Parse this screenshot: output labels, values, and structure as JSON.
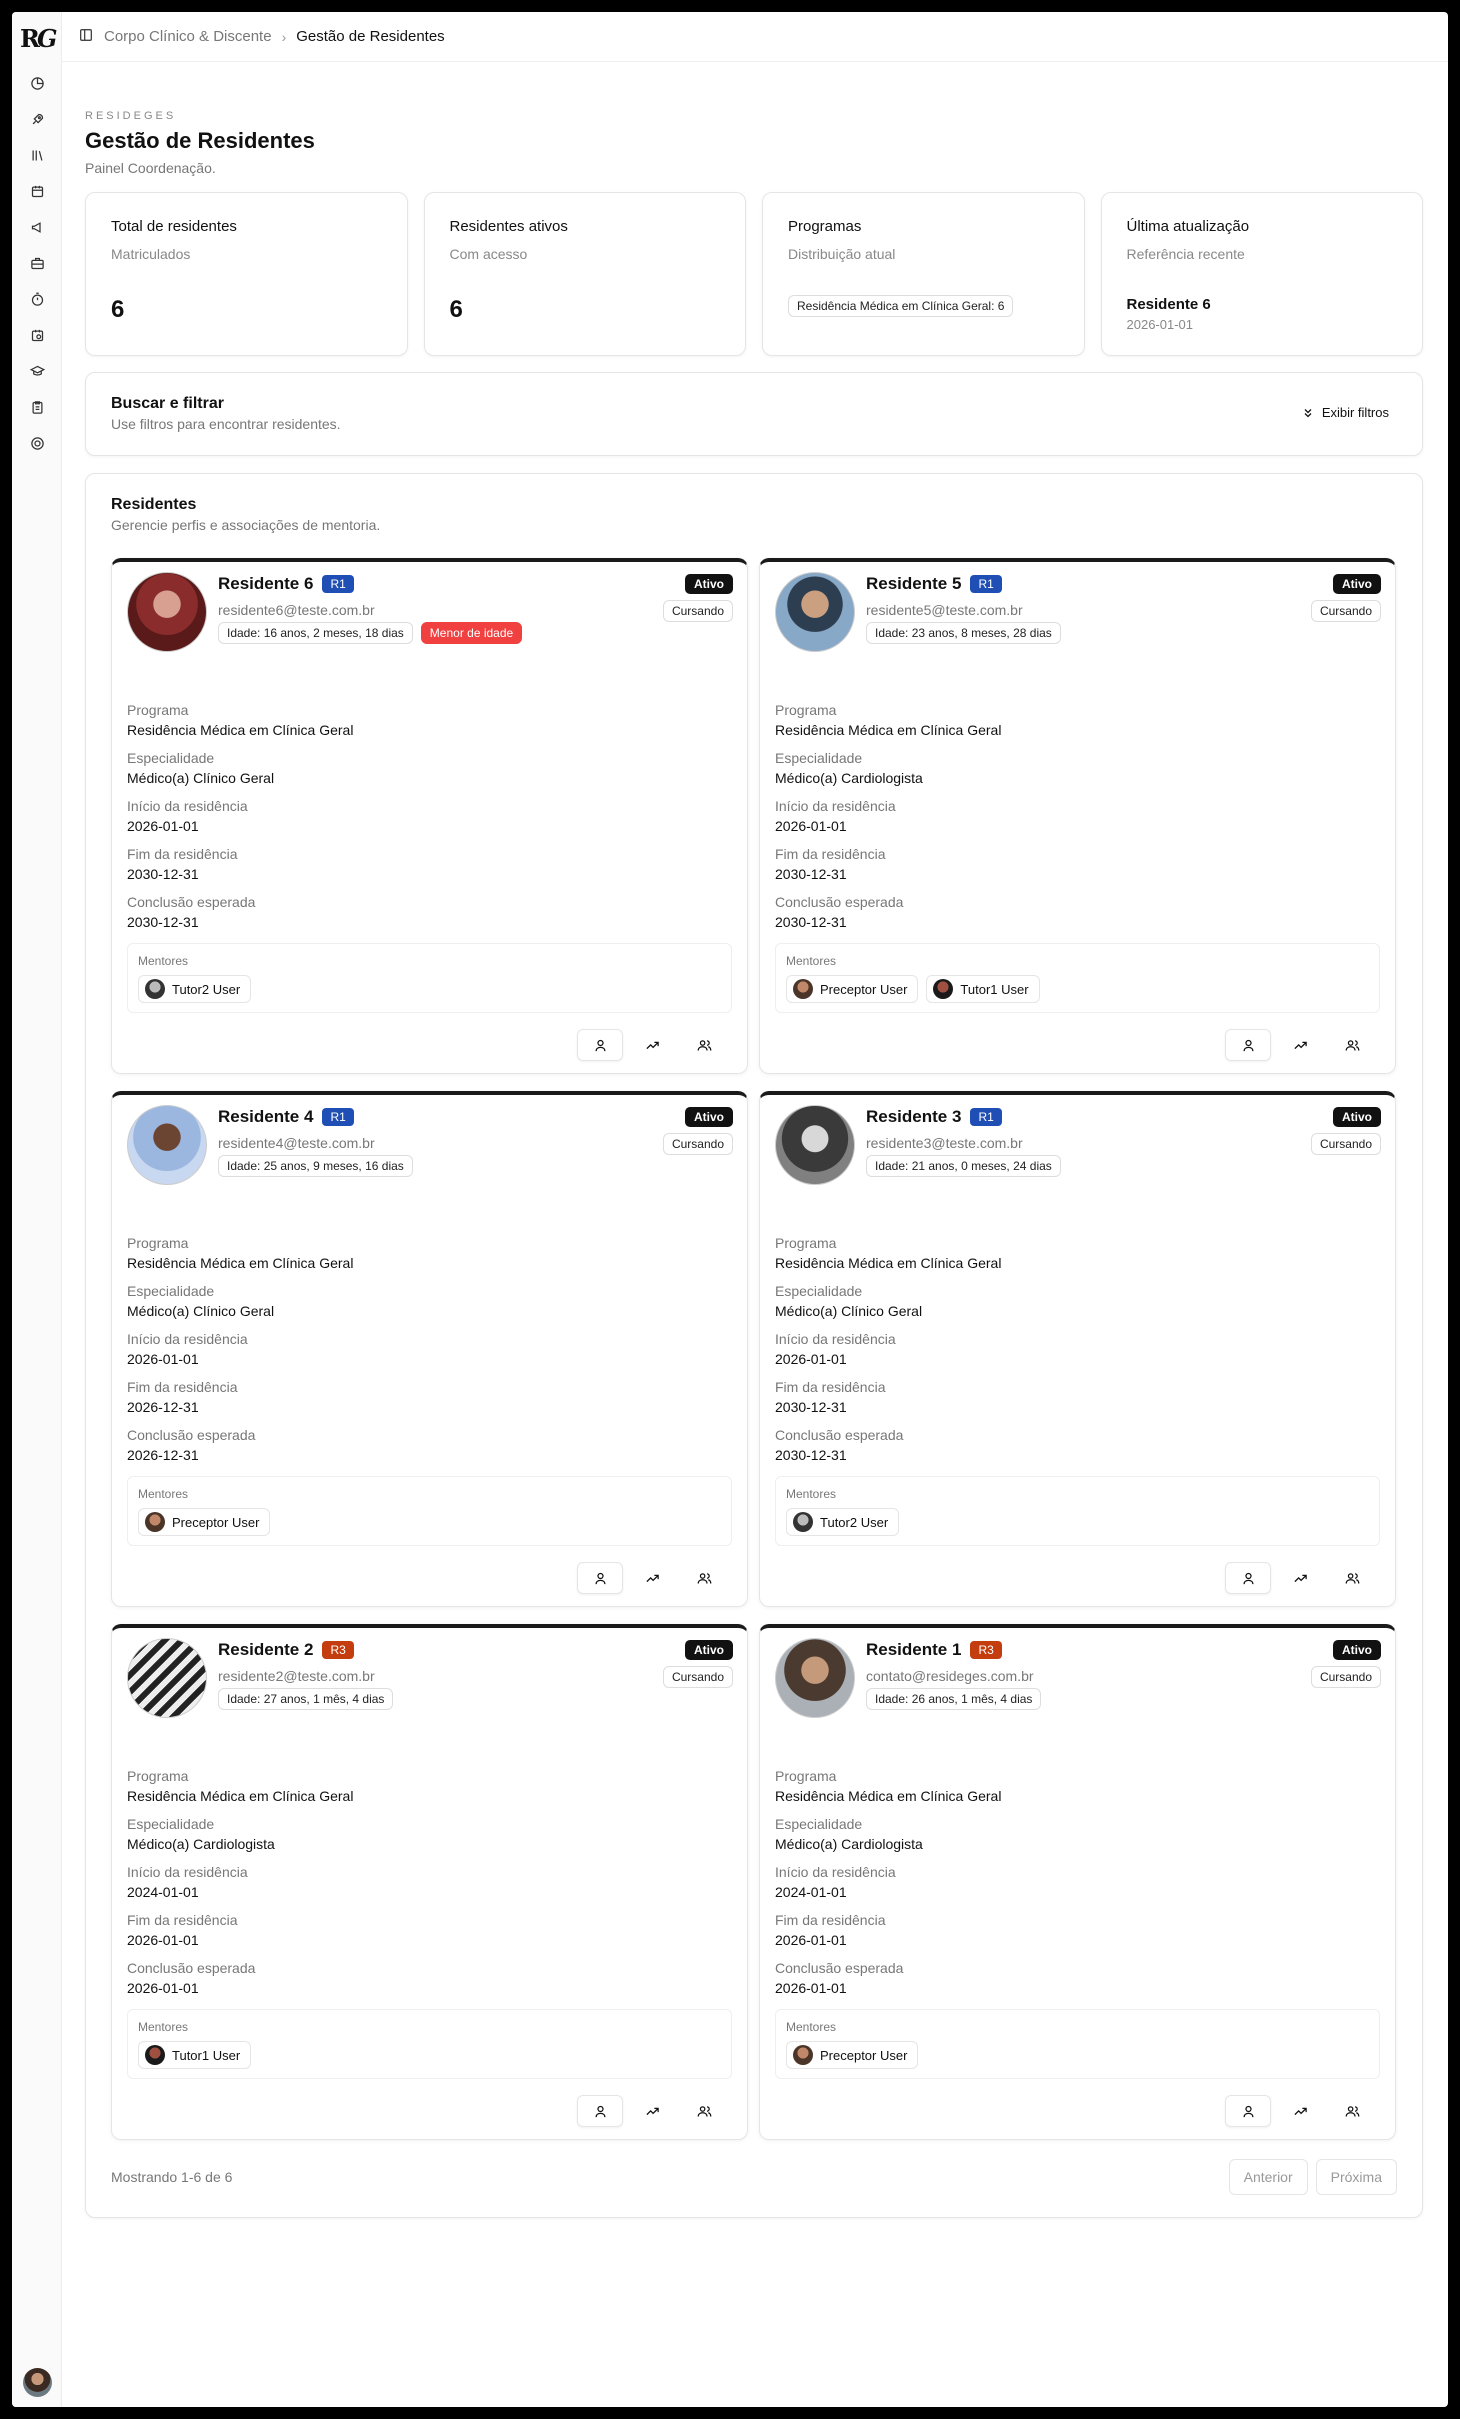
{
  "app": {
    "logo_text": "RG"
  },
  "breadcrumb": {
    "parent": "Corpo Clínico & Discente",
    "current": "Gestão de Residentes"
  },
  "sidebar": {
    "items": [
      "dashboard-icon",
      "rocket-icon",
      "library-icon",
      "calendar-icon",
      "megaphone-icon",
      "briefcase-icon",
      "stopwatch-icon",
      "calendar-clock-icon",
      "graduation-cap-icon",
      "clipboard-icon",
      "support-icon"
    ]
  },
  "header": {
    "eyebrow": "RESIDEGES",
    "title": "Gestão de Residentes",
    "subtitle": "Painel Coordenação."
  },
  "stats": {
    "total": {
      "title": "Total de residentes",
      "subtitle": "Matriculados",
      "value": "6"
    },
    "active": {
      "title": "Residentes ativos",
      "subtitle": "Com acesso",
      "value": "6"
    },
    "programs": {
      "title": "Programas",
      "subtitle": "Distribuição atual",
      "pill": "Residência Médica em Clínica Geral: 6"
    },
    "last": {
      "title": "Última atualização",
      "subtitle": "Referência recente",
      "name": "Residente 6",
      "date": "2026-01-01"
    }
  },
  "filter": {
    "title": "Buscar e filtrar",
    "subtitle": "Use filtros para encontrar residentes.",
    "button": "Exibir filtros"
  },
  "list": {
    "title": "Residentes",
    "subtitle": "Gerencie perfis e associações de mentoria."
  },
  "labels": {
    "program": "Programa",
    "specialty": "Especialidade",
    "start": "Início da residência",
    "end": "Fim da residência",
    "expected": "Conclusão esperada",
    "mentors": "Mentores"
  },
  "colors": {
    "r1": "#1f4fb4",
    "r3": "#c43d0e",
    "minor": "#f04040",
    "status": "#111111"
  },
  "residents": [
    {
      "name": "Residente 6",
      "year": "R1",
      "email": "residente6@teste.com.br",
      "age": "Idade: 16 anos, 2 meses, 18 dias",
      "minor": "Menor de idade",
      "status": "Ativo",
      "phase": "Cursando",
      "program": "Residência Médica em Clínica Geral",
      "specialty": "Médico(a) Clínico Geral",
      "start": "2026-01-01",
      "end": "2030-12-31",
      "expected": "2030-12-31",
      "mentors": [
        "Tutor2 User"
      ]
    },
    {
      "name": "Residente 5",
      "year": "R1",
      "email": "residente5@teste.com.br",
      "age": "Idade: 23 anos, 8 meses, 28 dias",
      "status": "Ativo",
      "phase": "Cursando",
      "program": "Residência Médica em Clínica Geral",
      "specialty": "Médico(a) Cardiologista",
      "start": "2026-01-01",
      "end": "2030-12-31",
      "expected": "2030-12-31",
      "mentors": [
        "Preceptor User",
        "Tutor1 User"
      ]
    },
    {
      "name": "Residente 4",
      "year": "R1",
      "email": "residente4@teste.com.br",
      "age": "Idade: 25 anos, 9 meses, 16 dias",
      "status": "Ativo",
      "phase": "Cursando",
      "program": "Residência Médica em Clínica Geral",
      "specialty": "Médico(a) Clínico Geral",
      "start": "2026-01-01",
      "end": "2026-12-31",
      "expected": "2026-12-31",
      "mentors": [
        "Preceptor User"
      ]
    },
    {
      "name": "Residente 3",
      "year": "R1",
      "email": "residente3@teste.com.br",
      "age": "Idade: 21 anos, 0 meses, 24 dias",
      "status": "Ativo",
      "phase": "Cursando",
      "program": "Residência Médica em Clínica Geral",
      "specialty": "Médico(a) Clínico Geral",
      "start": "2026-01-01",
      "end": "2030-12-31",
      "expected": "2030-12-31",
      "mentors": [
        "Tutor2 User"
      ]
    },
    {
      "name": "Residente 2",
      "year": "R3",
      "email": "residente2@teste.com.br",
      "age": "Idade: 27 anos, 1 mês, 4 dias",
      "status": "Ativo",
      "phase": "Cursando",
      "program": "Residência Médica em Clínica Geral",
      "specialty": "Médico(a) Cardiologista",
      "start": "2024-01-01",
      "end": "2026-01-01",
      "expected": "2026-01-01",
      "mentors": [
        "Tutor1 User"
      ]
    },
    {
      "name": "Residente 1",
      "year": "R3",
      "email": "contato@resideges.com.br",
      "age": "Idade: 26 anos, 1 mês, 4 dias",
      "status": "Ativo",
      "phase": "Cursando",
      "program": "Residência Médica em Clínica Geral",
      "specialty": "Médico(a) Cardiologista",
      "start": "2024-01-01",
      "end": "2026-01-01",
      "expected": "2026-01-01",
      "mentors": [
        "Preceptor User"
      ]
    }
  ],
  "pagination": {
    "summary": "Mostrando 1-6 de 6",
    "prev": "Anterior",
    "next": "Próxima"
  }
}
